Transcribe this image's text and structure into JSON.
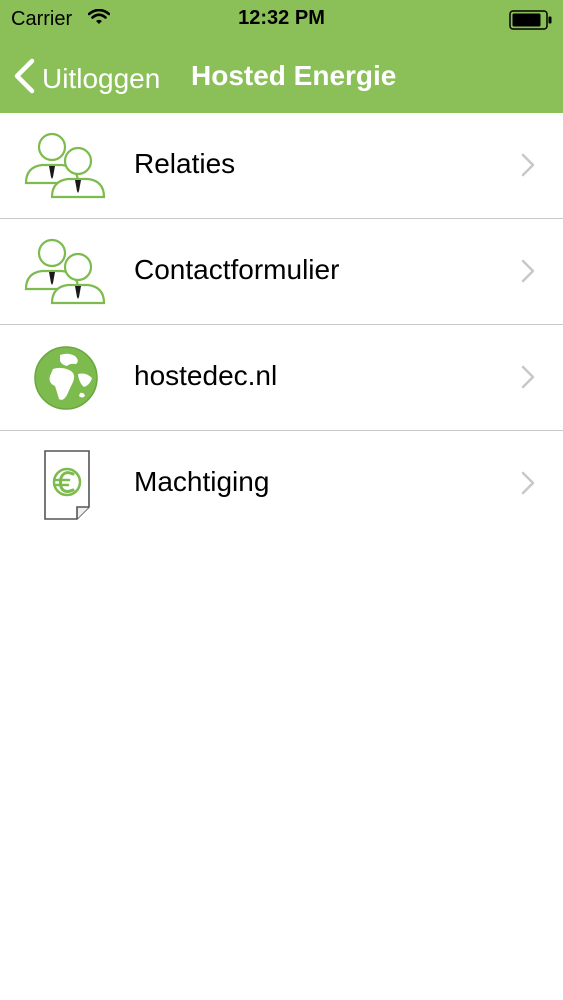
{
  "status_bar": {
    "carrier": "Carrier",
    "time": "12:32 PM"
  },
  "nav": {
    "back_label": "Uitloggen",
    "title": "Hosted Energie"
  },
  "menu": {
    "items": [
      {
        "label": "Relaties",
        "icon": "people-icon"
      },
      {
        "label": "Contactformulier",
        "icon": "people-icon"
      },
      {
        "label": "hostedec.nl",
        "icon": "globe-icon"
      },
      {
        "label": "Machtiging",
        "icon": "euro-document-icon"
      }
    ]
  },
  "colors": {
    "brand_green": "#8bc058",
    "icon_green": "#7dbb4e",
    "separator": "#c8c7cc",
    "chevron": "#c7c7cc"
  }
}
